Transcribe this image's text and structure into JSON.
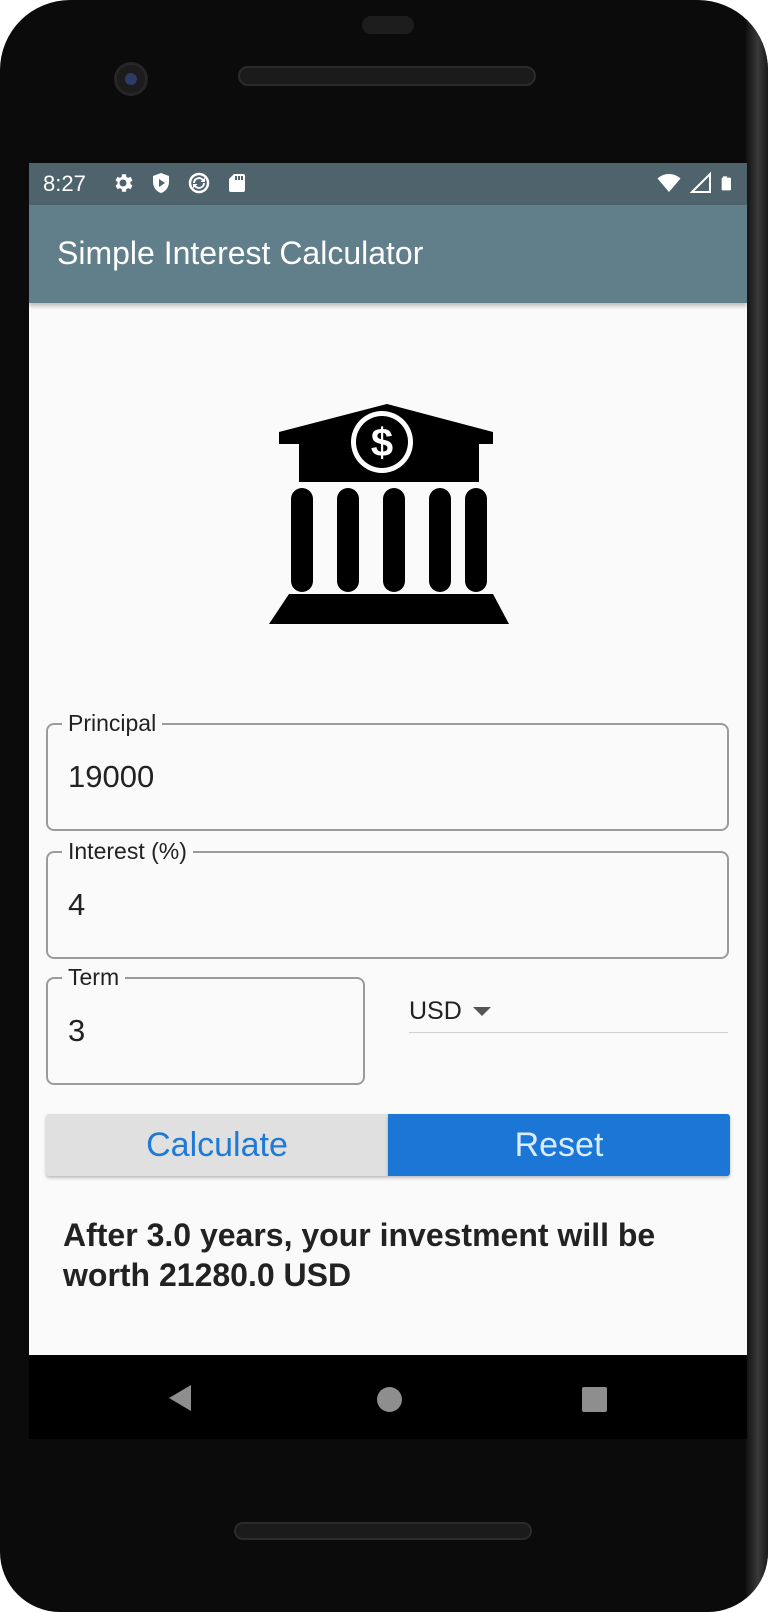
{
  "status_bar": {
    "time": "8:27",
    "left_icons": [
      "settings-icon",
      "shield-icon",
      "sync-icon",
      "sd-card-icon"
    ],
    "right_icons": [
      "wifi-icon",
      "signal-icon",
      "battery-icon"
    ]
  },
  "app_bar": {
    "title": "Simple Interest Calculator"
  },
  "logo": {
    "icon": "bank-icon"
  },
  "form": {
    "principal": {
      "label": "Principal",
      "value": "19000"
    },
    "interest": {
      "label": "Interest (%)",
      "value": "4"
    },
    "term": {
      "label": "Term",
      "value": "3"
    },
    "currency": {
      "selected": "USD"
    }
  },
  "buttons": {
    "calculate": "Calculate",
    "reset": "Reset"
  },
  "result": {
    "text": "After 3.0 years, your investment will be worth 21280.0 USD"
  },
  "colors": {
    "status_bar": "#4e636c",
    "app_bar": "#617e8b",
    "accent": "#1b76d6",
    "calculate_bg": "#e0e0e0"
  },
  "nav": {
    "icons": [
      "back-icon",
      "home-icon",
      "recents-icon"
    ]
  }
}
